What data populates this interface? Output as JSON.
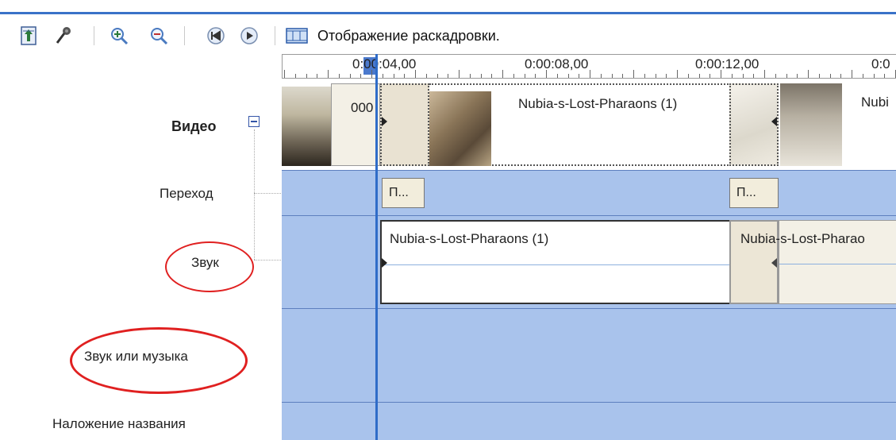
{
  "toolbar": {
    "icons": [
      "storyboard-toggle-icon",
      "narrate-microphone-icon",
      "zoom-in-icon",
      "zoom-out-icon",
      "rewind-icon",
      "play-icon",
      "storyboard-icon"
    ],
    "storyboard_label": "Отображение раскадровки."
  },
  "ruler": {
    "labels": [
      "0:00:04,00",
      "0:00:08,00",
      "0:00:12,00",
      "0:0"
    ]
  },
  "tracks": {
    "video": "Видео",
    "transition": "Переход",
    "audio": "Звук",
    "music": "Звук или музыка",
    "title_overlay": "Наложение названия"
  },
  "video_clips": {
    "first_partial": "000",
    "main_title": "Nubia-s-Lost-Pharaons (1)",
    "next_partial": "Nubi"
  },
  "transitions": [
    "П...",
    "П..."
  ],
  "audio_clips": {
    "main_title": "Nubia-s-Lost-Pharaons (1)",
    "overlap_title": "Nubia-s-Lost-Pharao"
  },
  "colors": {
    "track_bg": "#a9c3ec",
    "accent": "#2f6cc8",
    "annotation_circle": "#e02020"
  }
}
